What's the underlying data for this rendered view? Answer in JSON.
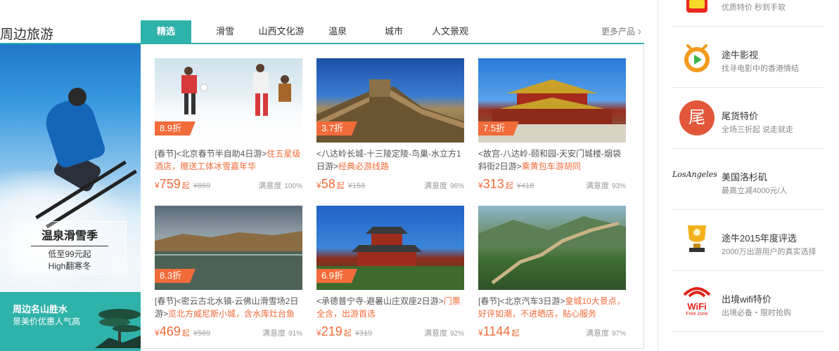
{
  "section": {
    "title": "周边旅游",
    "tabs": [
      "精选",
      "滑雪",
      "山西文化游",
      "温泉",
      "城市",
      "人文景观"
    ],
    "more": "更多产品"
  },
  "banner": {
    "title": "温泉滑雪季",
    "line1": "低至99元起",
    "line2": "High翻寒冬",
    "bottom_title": "周边名山胜水",
    "bottom_sub": "景美价优惠人气高"
  },
  "cards": [
    {
      "badge": "8.9折",
      "tag": "[春节]",
      "title": "<北京春节半自助4日游>",
      "highlight": "住五星级酒店，赠送工体冰雪嘉年华",
      "currency": "¥",
      "price": "759",
      "unit": "起",
      "orig": "¥859",
      "sat_label": "满意度",
      "sat": "100%"
    },
    {
      "badge": "3.7折",
      "tag": "",
      "title": "<八达岭长城-十三陵定陵-鸟巢-水立方1日游>",
      "highlight": "经典必游线路",
      "currency": "¥",
      "price": "58",
      "unit": "起",
      "orig": "¥158",
      "sat_label": "满意度",
      "sat": "96%"
    },
    {
      "badge": "7.5折",
      "tag": "",
      "title": "<故宫-八达岭-颐和园-天安门城楼-烟袋斜街2日游>",
      "highlight": "乘黄包车游胡同",
      "currency": "¥",
      "price": "313",
      "unit": "起",
      "orig": "¥418",
      "sat_label": "满意度",
      "sat": "93%"
    },
    {
      "badge": "8.3折",
      "tag": "[春节]",
      "title": "<密云古北水镇-云佛山滑雪场2日游>",
      "highlight": "览北方威尼斯小城，含水库灶台鱼",
      "currency": "¥",
      "price": "469",
      "unit": "起",
      "orig": "¥569",
      "sat_label": "满意度",
      "sat": "91%"
    },
    {
      "badge": "6.9折",
      "tag": "",
      "title": "<承德普宁寺-避暑山庄双座2日游>",
      "highlight": "门票全含，出游首选",
      "currency": "¥",
      "price": "219",
      "unit": "起",
      "orig": "¥319",
      "sat_label": "满意度",
      "sat": "92%"
    },
    {
      "badge": "",
      "tag": "[春节]",
      "title": "<北京汽车3日游>",
      "highlight": "皇城10大景点，好评如潮，不进晒店，贴心服务",
      "currency": "¥",
      "price": "1144",
      "unit": "起",
      "orig": "",
      "sat_label": "满意度",
      "sat": "97%"
    }
  ],
  "sidebar": [
    {
      "title": "",
      "sub": "优质特价 秒到手软",
      "icon": "seckill-icon"
    },
    {
      "title": "途牛影视",
      "sub": "找寻电影中的香港情结",
      "icon": "video-icon"
    },
    {
      "title": "尾货特价",
      "sub": "全场三折起 说走就走",
      "icon": "tail-sale-icon",
      "icon_text": "尾"
    },
    {
      "title": "美国洛杉矶",
      "sub": "最高立减4000元/人",
      "icon": "los-angeles-icon",
      "icon_text": "LosAngeles"
    },
    {
      "title": "途牛2015年度评选",
      "sub": "2000万出游用户的真实选择",
      "icon": "trophy-icon"
    },
    {
      "title": "出境wifi特价",
      "sub": "出境必备・限时抢购",
      "icon": "wifi-icon",
      "icon_text": "WiFi",
      "icon_text2": "Free zone"
    }
  ],
  "colors": {
    "accent": "#2fb2aa",
    "price": "#f26b3a",
    "badge": "#f26b3a"
  }
}
